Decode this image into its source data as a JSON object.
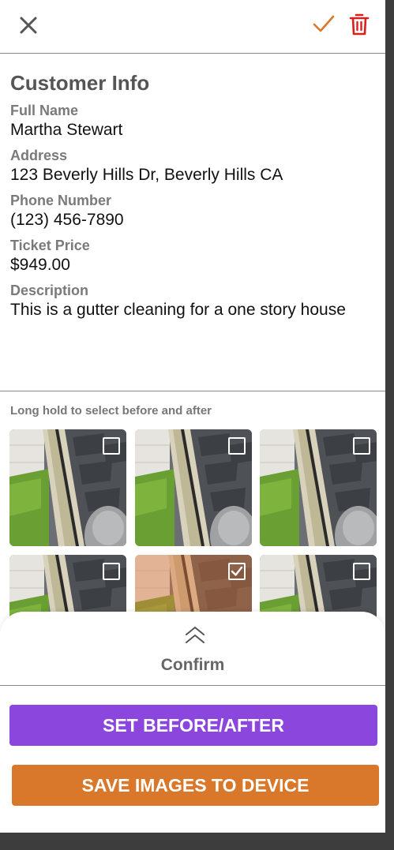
{
  "header": {
    "close_icon": "close-icon",
    "confirm_icon": "checkmark-icon",
    "delete_icon": "trash-icon",
    "colors": {
      "confirm": "#d9772a",
      "delete": "#d9211b"
    }
  },
  "customer": {
    "title": "Customer Info",
    "fields": [
      {
        "label": "Full Name",
        "value": "Martha Stewart"
      },
      {
        "label": "Address",
        "value": "123 Beverly Hills Dr, Beverly Hills CA"
      },
      {
        "label": "Phone Number",
        "value": "(123) 456-7890"
      },
      {
        "label": "Ticket Price",
        "value": "$949.00"
      },
      {
        "label": "Description",
        "value": "This is a gutter cleaning for a one story house"
      }
    ]
  },
  "gallery": {
    "hint": "Long hold to select before and after",
    "images": [
      {
        "selected": false
      },
      {
        "selected": false
      },
      {
        "selected": false
      },
      {
        "selected": false
      },
      {
        "selected": true
      },
      {
        "selected": false
      }
    ]
  },
  "sheet": {
    "expand_icon": "double-chevron-up-icon",
    "confirm_label": "Confirm",
    "set_before_after": "SET BEFORE/AFTER",
    "save_images": "SAVE IMAGES TO DEVICE",
    "colors": {
      "primary": "#8b46dd",
      "secondary": "#d9772a"
    }
  }
}
